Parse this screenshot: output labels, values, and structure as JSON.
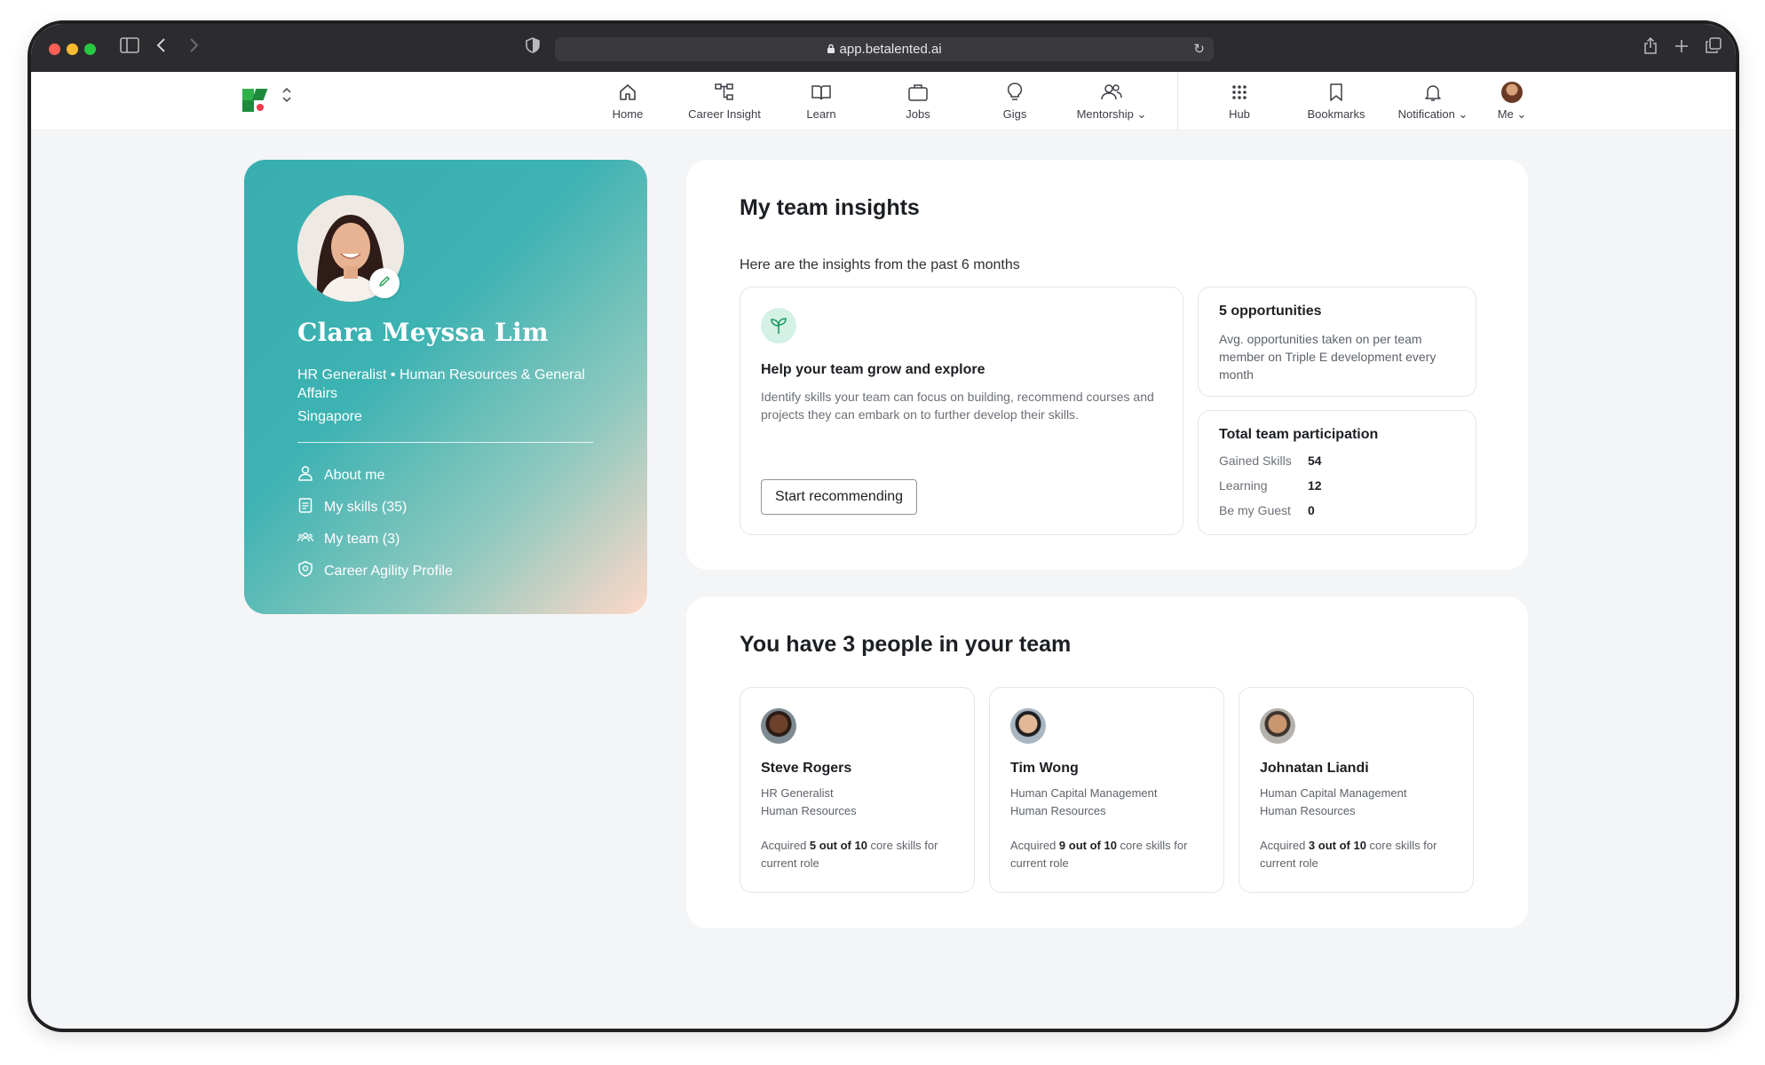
{
  "browser": {
    "url": "app.betalented.ai"
  },
  "nav": {
    "items": [
      {
        "label": "Home",
        "icon": "home-icon"
      },
      {
        "label": "Career Insight",
        "icon": "career-insight-icon"
      },
      {
        "label": "Learn",
        "icon": "book-icon"
      },
      {
        "label": "Jobs",
        "icon": "briefcase-icon"
      },
      {
        "label": "Gigs",
        "icon": "lightbulb-icon"
      },
      {
        "label": "Mentorship",
        "icon": "people-icon"
      },
      {
        "label": "Hub",
        "icon": "grid-icon"
      },
      {
        "label": "Bookmarks",
        "icon": "bookmark-icon"
      },
      {
        "label": "Notification",
        "icon": "bell-icon"
      },
      {
        "label": "Me",
        "icon": "avatar"
      }
    ]
  },
  "profile": {
    "name": "Clara Meyssa Lim",
    "role": "HR Generalist • Human Resources & General Affairs",
    "location": "Singapore",
    "links": [
      "About me",
      "My skills (35)",
      "My team (3)",
      "Career Agility Profile"
    ]
  },
  "insights": {
    "title": "My team insights",
    "subtitle": "Here are the insights from the past 6 months",
    "grow": {
      "title": "Help your team grow and explore",
      "description": "Identify skills your team can focus on building, recommend courses and projects they can embark on to further develop their skills.",
      "button": "Start recommending"
    },
    "opportunities": {
      "title": "5 opportunities",
      "description": "Avg. opportunities taken on per team member on Triple E development every month"
    },
    "participation": {
      "title": "Total team participation",
      "rows": [
        {
          "label": "Gained Skills",
          "value": "54"
        },
        {
          "label": "Learning",
          "value": "12"
        },
        {
          "label": "Be my Guest",
          "value": "0"
        }
      ]
    }
  },
  "team": {
    "title": "You have 3 people in your team",
    "members": [
      {
        "name": "Steve Rogers",
        "role": "HR Generalist",
        "dept": "Human Resources",
        "skills_pre": "Acquired ",
        "skills_bold": "5 out of 10",
        "skills_post": " core skills for current role"
      },
      {
        "name": "Tim Wong",
        "role": "Human Capital Management",
        "dept": "Human Resources",
        "skills_pre": "Acquired ",
        "skills_bold": "9 out of 10",
        "skills_post": " core skills for current role"
      },
      {
        "name": "Johnatan Liandi",
        "role": "Human Capital Management",
        "dept": "Human Resources",
        "skills_pre": "Acquired ",
        "skills_bold": "3 out of 10",
        "skills_post": " core skills for current role"
      }
    ]
  }
}
